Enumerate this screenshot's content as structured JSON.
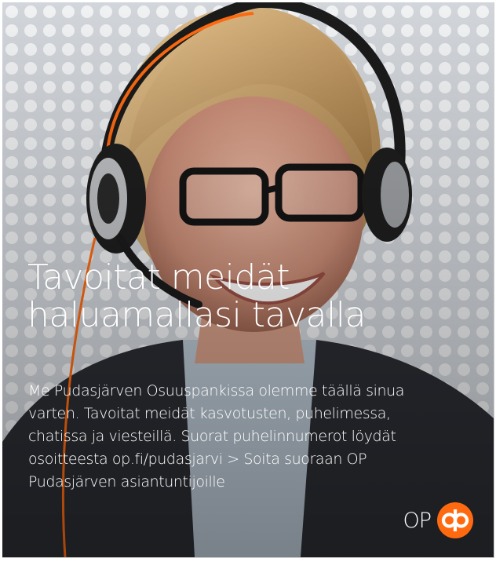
{
  "ad": {
    "headline": [
      "Tavoitat meidät",
      "haluamallasi tavalla"
    ],
    "body_lines": [
      "Me Pudasjärven Osuuspankissa olemme täällä sinua",
      "varten. Tavoitat meidät kasvotusten, puhelimessa,",
      "chatissa ja viesteillä. Suorat puhelinnumerot löydät",
      "osoitteesta op.fi/pudasjarvi > Soita suoraan OP",
      "Pudasjärven asiantuntijoille"
    ],
    "logo_text": "OP"
  },
  "colors": {
    "brand_orange": "#ff6a10",
    "text": "#ffffff",
    "jacket": "#2b2d33",
    "shirt": "#b9c6d2"
  }
}
